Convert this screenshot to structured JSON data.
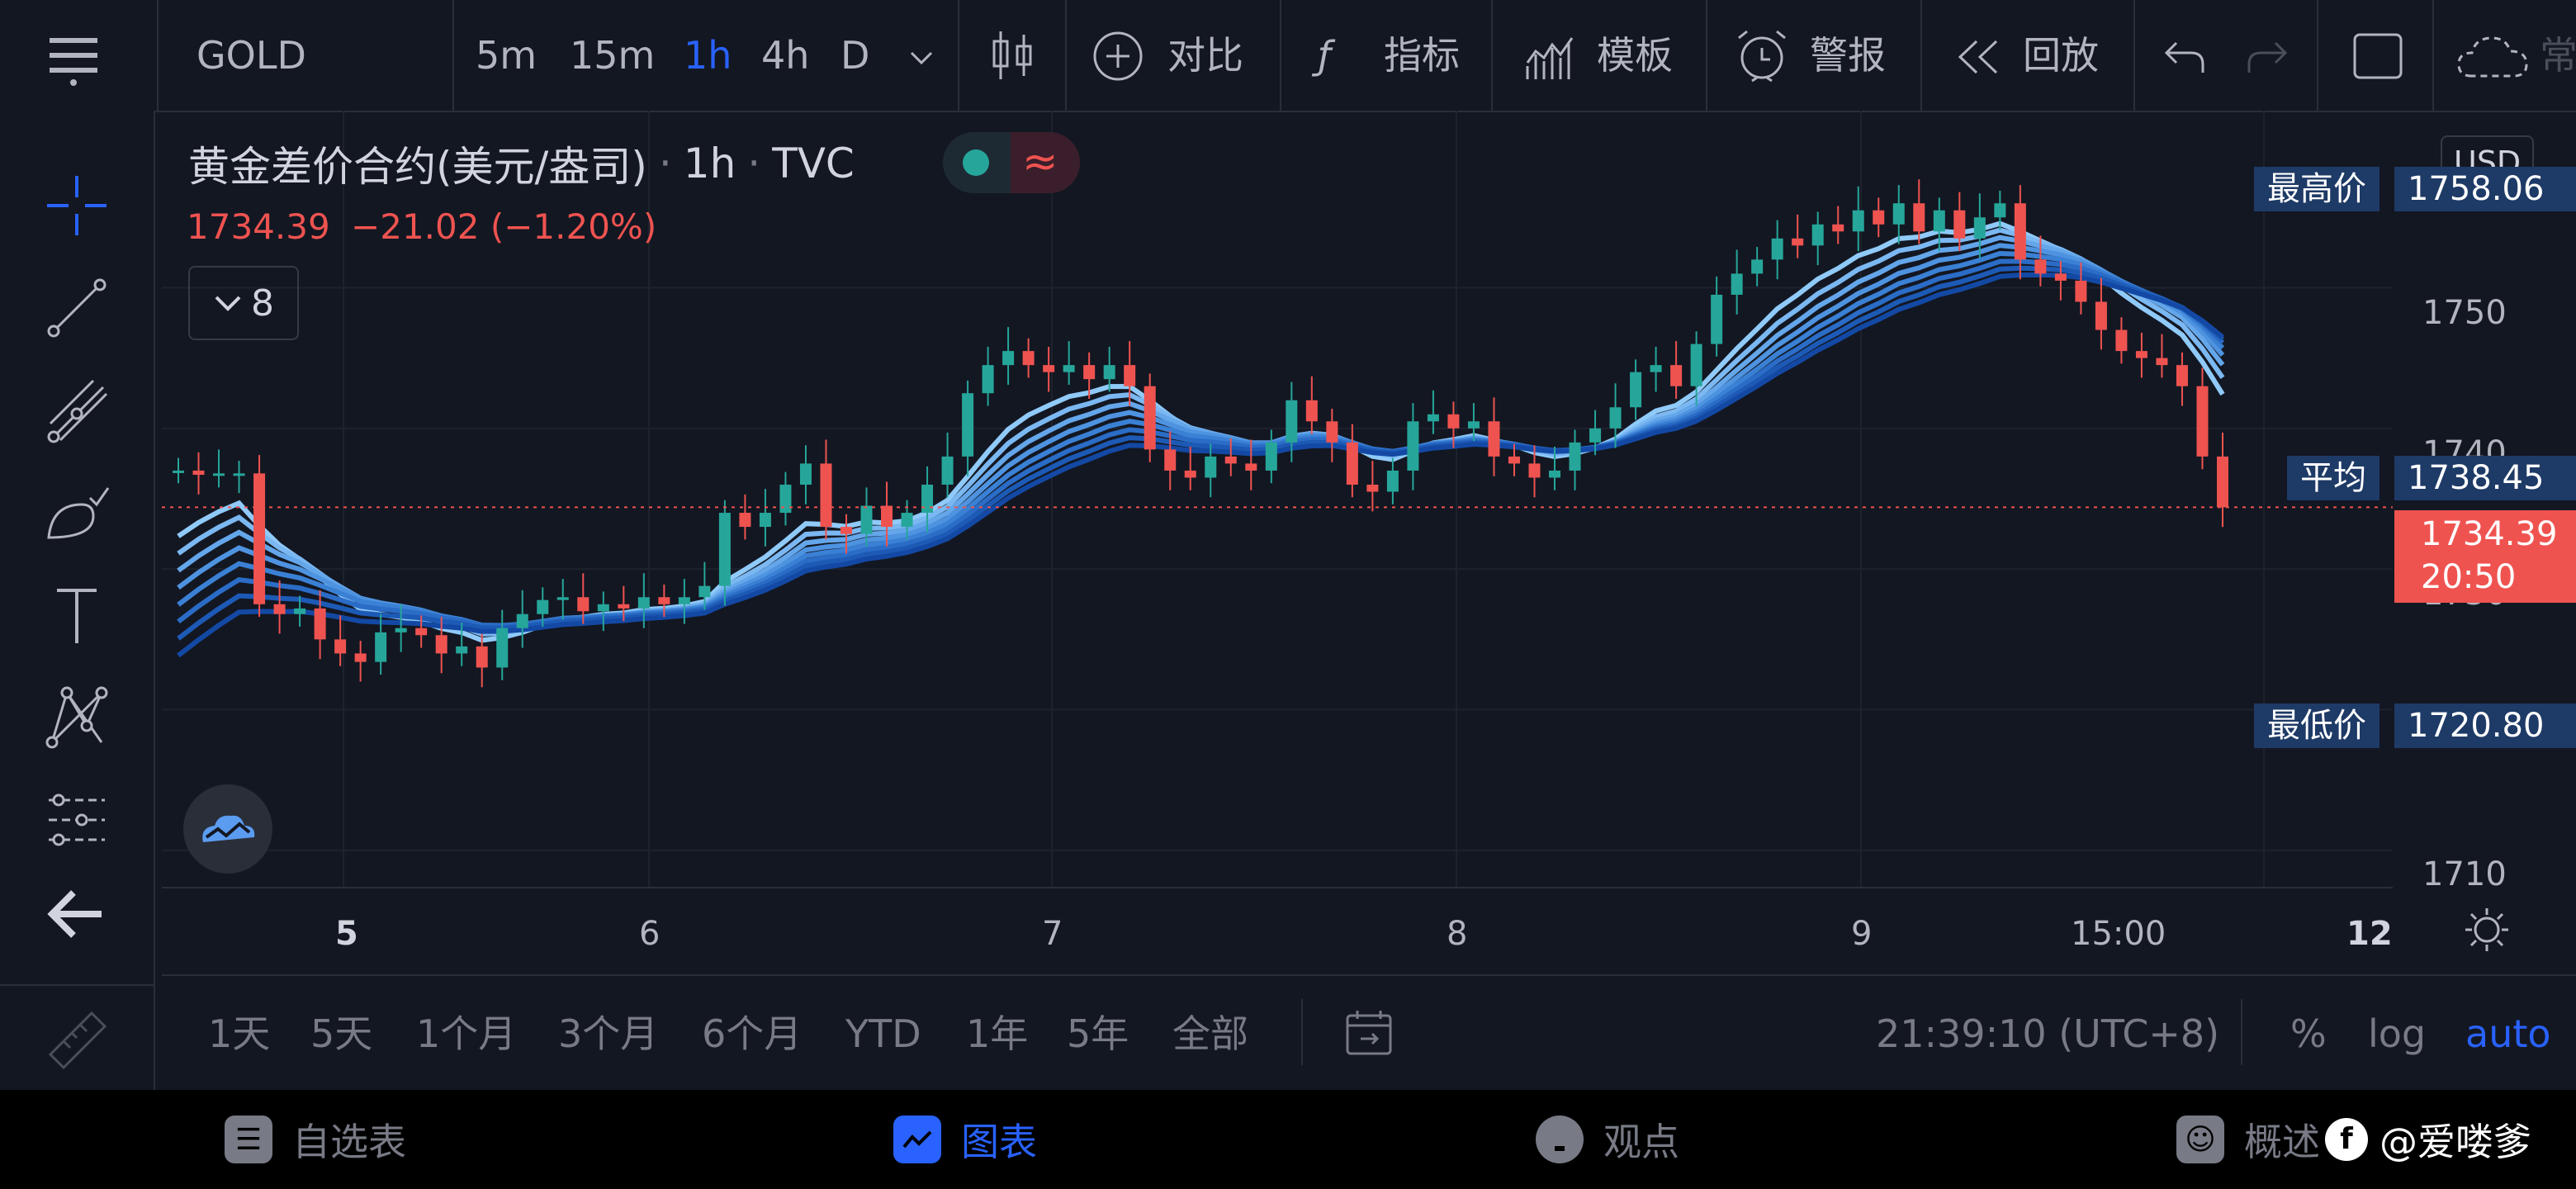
{
  "toolbar": {
    "symbol": "GOLD",
    "intervals": [
      "5m",
      "15m",
      "1h",
      "4h",
      "D"
    ],
    "active_interval": "1h",
    "compare": "对比",
    "indicators": "指标",
    "templates": "模板",
    "alerts": "警报",
    "replay": "回放",
    "partial_label": "常"
  },
  "legend": {
    "title": "黄金差价合约(美元/盎司)",
    "interval": "1h",
    "source": "TVC",
    "price": "1734.39",
    "change": "−21.02 (−1.20%)",
    "indicator_count": "8",
    "separator": "·"
  },
  "price_axis": {
    "currency": "USD",
    "ticks": [
      "1750",
      "1740",
      "1730",
      "1720",
      "1710"
    ],
    "high_label": "最高价",
    "high_value": "1758.06",
    "avg_label": "平均",
    "avg_value": "1738.45",
    "low_label": "最低价",
    "low_value": "1720.80",
    "last_value": "1734.39",
    "countdown": "20:50"
  },
  "time_axis": {
    "labels": [
      "5",
      "6",
      "7",
      "8",
      "9",
      "15:00",
      "12"
    ]
  },
  "range_bar": {
    "ranges": [
      "1天",
      "5天",
      "1个月",
      "3个月",
      "6个月",
      "YTD",
      "1年",
      "5年",
      "全部"
    ],
    "clock": "21:39:10 (UTC+8)",
    "percent": "%",
    "log": "log",
    "auto": "auto"
  },
  "bottom_nav": {
    "watchlist": "自选表",
    "chart": "图表",
    "ideas": "观点",
    "overview": "概述",
    "watermark": "@爱喽爹"
  },
  "colors": {
    "background": "#131722",
    "up": "#26a69a",
    "down": "#ef5350",
    "accent": "#2962ff",
    "tag_blue": "#1e3a66",
    "ribbon_light": "#90caf9",
    "ribbon_dark": "#0d47a1"
  },
  "chart_data": {
    "type": "candlestick",
    "symbol": "GOLD",
    "interval": "1h",
    "y_range": [
      1708,
      1762
    ],
    "x_labels": [
      "5",
      "6",
      "7",
      "8",
      "9",
      "15:00",
      "12"
    ],
    "high": 1758.06,
    "low": 1720.8,
    "average": 1738.45,
    "last": 1734.39,
    "closes": [
      1737.0,
      1736.7,
      1736.8,
      1736.8,
      1727.5,
      1726.8,
      1727.2,
      1725.0,
      1724.0,
      1723.4,
      1725.5,
      1725.8,
      1725.3,
      1724.0,
      1724.5,
      1723.0,
      1725.8,
      1726.8,
      1727.8,
      1728.0,
      1727.0,
      1727.5,
      1727.2,
      1728.0,
      1727.5,
      1728.0,
      1728.8,
      1734.0,
      1733.0,
      1734.0,
      1736.0,
      1737.5,
      1733.0,
      1732.5,
      1734.5,
      1733.0,
      1734.0,
      1736.0,
      1738.0,
      1742.5,
      1744.5,
      1745.5,
      1744.5,
      1744.0,
      1744.5,
      1743.5,
      1744.5,
      1743.0,
      1738.5,
      1737.0,
      1736.5,
      1738.0,
      1737.5,
      1737.0,
      1739.0,
      1742.0,
      1740.5,
      1739.0,
      1736.0,
      1735.5,
      1737.0,
      1740.5,
      1741.0,
      1740.0,
      1740.5,
      1738.0,
      1737.5,
      1736.5,
      1737.0,
      1739.0,
      1740.0,
      1741.5,
      1744.0,
      1744.5,
      1743.0,
      1746.0,
      1749.5,
      1751.0,
      1752.0,
      1753.5,
      1753.0,
      1754.5,
      1754.0,
      1755.5,
      1754.5,
      1756.0,
      1754.0,
      1755.5,
      1753.5,
      1755.0,
      1756.0,
      1752.0,
      1751.0,
      1750.5,
      1749.0,
      1747.0,
      1745.5,
      1745.0,
      1744.5,
      1743.0,
      1738.0,
      1734.39
    ]
  }
}
